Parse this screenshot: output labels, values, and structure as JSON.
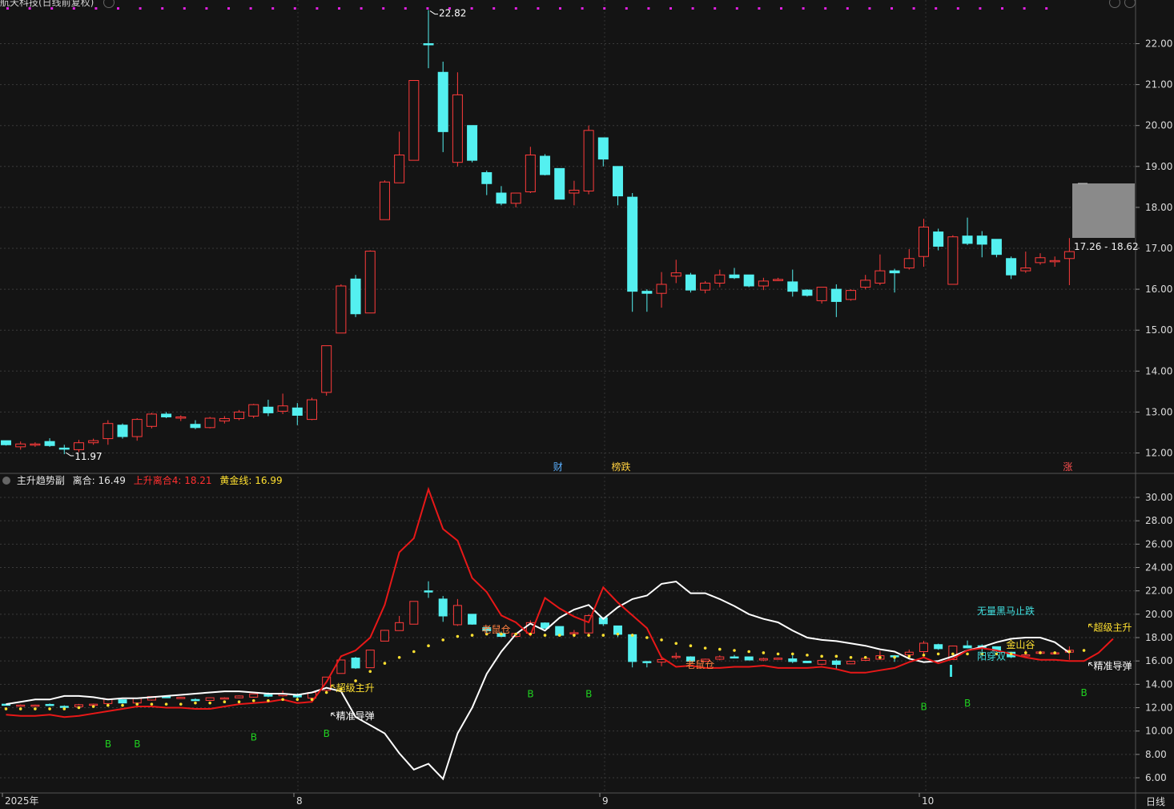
{
  "window": {
    "title": "航天科技(日线前复权)"
  },
  "indicator": {
    "name": "主升趋势副",
    "line1_label": "离合: 16.49",
    "line2_label": "上升离合4: 18.21",
    "line3_label": "黄金线: 16.99"
  },
  "timeframe_label": "日线",
  "colors": {
    "up": "#ff3b3b",
    "down": "#54f0f0",
    "white_line": "#ffffff",
    "red_line": "#e81818",
    "gold": "#ffe030",
    "buy": "#20d020",
    "grid": "#3a3a3a",
    "bg": "#141414"
  },
  "chart_data": [
    {
      "type": "candlestick",
      "name": "price",
      "y_ticks": [
        "22.00",
        "21.00",
        "20.00",
        "19.00",
        "18.00",
        "17.00",
        "16.00",
        "15.00",
        "14.00",
        "13.00",
        "12.00"
      ],
      "ylim": [
        11.5,
        23.0
      ],
      "ohlc": [
        [
          12.3,
          12.3,
          12.18,
          12.2
        ],
        [
          12.15,
          12.28,
          12.08,
          12.22
        ],
        [
          12.2,
          12.26,
          12.15,
          12.22
        ],
        [
          12.28,
          12.36,
          12.15,
          12.18
        ],
        [
          12.12,
          12.2,
          11.97,
          12.1
        ],
        [
          12.08,
          12.32,
          12.02,
          12.25
        ],
        [
          12.25,
          12.35,
          12.2,
          12.3
        ],
        [
          12.35,
          12.8,
          12.2,
          12.72
        ],
        [
          12.68,
          12.72,
          12.35,
          12.4
        ],
        [
          12.4,
          12.85,
          12.3,
          12.82
        ],
        [
          12.65,
          12.98,
          12.6,
          12.95
        ],
        [
          12.95,
          13.0,
          12.85,
          12.88
        ],
        [
          12.86,
          12.92,
          12.78,
          12.88
        ],
        [
          12.7,
          12.8,
          12.58,
          12.62
        ],
        [
          12.62,
          12.88,
          12.6,
          12.85
        ],
        [
          12.78,
          12.9,
          12.72,
          12.84
        ],
        [
          12.84,
          13.05,
          12.8,
          13.0
        ],
        [
          12.9,
          13.2,
          12.85,
          13.18
        ],
        [
          13.12,
          13.3,
          12.9,
          12.98
        ],
        [
          13.02,
          13.45,
          12.95,
          13.15
        ],
        [
          13.1,
          13.22,
          12.68,
          12.92
        ],
        [
          12.82,
          13.35,
          12.8,
          13.3
        ],
        [
          13.48,
          14.62,
          13.4,
          14.62
        ],
        [
          14.93,
          16.12,
          14.93,
          16.08
        ],
        [
          16.25,
          16.35,
          15.32,
          15.4
        ],
        [
          15.42,
          16.95,
          15.42,
          16.93
        ],
        [
          17.7,
          18.66,
          17.7,
          18.62
        ],
        [
          18.6,
          19.85,
          18.62,
          19.28
        ],
        [
          19.15,
          21.1,
          19.15,
          21.1
        ],
        [
          22.0,
          22.82,
          21.4,
          21.98
        ],
        [
          21.3,
          21.56,
          19.35,
          19.85
        ],
        [
          19.1,
          21.3,
          19.0,
          20.75
        ],
        [
          20.0,
          20.0,
          19.1,
          19.15
        ],
        [
          18.85,
          18.9,
          18.3,
          18.58
        ],
        [
          18.35,
          18.52,
          18.05,
          18.1
        ],
        [
          18.1,
          18.35,
          18.0,
          18.35
        ],
        [
          18.38,
          19.48,
          18.35,
          19.28
        ],
        [
          19.25,
          19.3,
          18.78,
          18.8
        ],
        [
          18.95,
          18.95,
          18.2,
          18.2
        ],
        [
          18.35,
          18.65,
          18.05,
          18.42
        ],
        [
          18.4,
          20.0,
          18.32,
          19.88
        ],
        [
          19.7,
          19.7,
          19.0,
          19.18
        ],
        [
          19.0,
          19.0,
          18.05,
          18.28
        ],
        [
          18.25,
          18.35,
          15.45,
          15.95
        ],
        [
          15.95,
          16.0,
          15.45,
          15.9
        ],
        [
          15.9,
          16.42,
          15.55,
          16.12
        ],
        [
          16.32,
          16.72,
          16.15,
          16.4
        ],
        [
          16.35,
          16.4,
          15.92,
          15.98
        ],
        [
          15.98,
          16.2,
          15.9,
          16.15
        ],
        [
          16.15,
          16.48,
          16.05,
          16.35
        ],
        [
          16.35,
          16.52,
          16.25,
          16.28
        ],
        [
          16.35,
          16.35,
          16.05,
          16.08
        ],
        [
          16.08,
          16.28,
          15.98,
          16.2
        ],
        [
          16.22,
          16.28,
          16.2,
          16.24
        ],
        [
          16.18,
          16.48,
          15.82,
          15.95
        ],
        [
          15.98,
          16.0,
          15.82,
          15.85
        ],
        [
          15.72,
          16.05,
          15.65,
          16.05
        ],
        [
          16.0,
          16.12,
          15.32,
          15.7
        ],
        [
          15.75,
          16.0,
          15.72,
          15.97
        ],
        [
          16.05,
          16.35,
          16.0,
          16.22
        ],
        [
          16.15,
          16.85,
          16.1,
          16.45
        ],
        [
          16.45,
          16.5,
          15.92,
          16.4
        ],
        [
          16.52,
          16.98,
          16.48,
          16.75
        ],
        [
          16.8,
          17.72,
          16.55,
          17.52
        ],
        [
          17.4,
          17.48,
          16.95,
          17.05
        ],
        [
          16.12,
          17.32,
          16.12,
          17.28
        ],
        [
          17.3,
          17.75,
          17.08,
          17.12
        ],
        [
          17.3,
          17.42,
          16.78,
          17.1
        ],
        [
          17.22,
          17.22,
          16.78,
          16.85
        ],
        [
          16.75,
          16.8,
          16.25,
          16.35
        ],
        [
          16.45,
          16.92,
          16.4,
          16.52
        ],
        [
          16.65,
          16.88,
          16.6,
          16.77
        ],
        [
          16.7,
          16.8,
          16.55,
          16.7
        ],
        [
          16.75,
          17.25,
          16.1,
          16.92
        ]
      ],
      "annotations": [
        {
          "text": "22.82",
          "candle": 29,
          "kind": "high"
        },
        {
          "text": "11.97",
          "candle": 4,
          "kind": "low"
        }
      ],
      "event_marks": [
        {
          "text": "财",
          "candle": 38,
          "color": "#5ab0ff"
        },
        {
          "text": "榜跌",
          "candle": 42,
          "color": "#ffd040"
        },
        {
          "text": "涨",
          "candle": 73,
          "color": "#ff5050"
        }
      ],
      "range_label": "17.26 - 18.62"
    },
    {
      "type": "line",
      "name": "主升趋势副",
      "y_ticks": [
        "30.00",
        "28.00",
        "26.00",
        "24.00",
        "22.00",
        "20.00",
        "18.00",
        "16.00",
        "14.00",
        "12.00",
        "10.00",
        "8.00",
        "6.00"
      ],
      "ylim": [
        5.0,
        31.2
      ],
      "x_ticks": [
        "2025年",
        "8",
        "9",
        "10"
      ],
      "series": [
        {
          "name": "离合",
          "color": "#ffffff",
          "values": [
            12.3,
            12.5,
            12.7,
            12.7,
            13.0,
            13.0,
            12.9,
            12.7,
            12.8,
            12.8,
            12.9,
            13.0,
            13.1,
            13.2,
            13.3,
            13.4,
            13.4,
            13.3,
            13.2,
            13.2,
            13.1,
            13.3,
            13.7,
            13.4,
            11.2,
            10.5,
            9.8,
            8.1,
            6.7,
            7.2,
            5.9,
            9.8,
            12.0,
            14.9,
            16.8,
            18.3,
            19.2,
            18.6,
            19.7,
            20.4,
            20.8,
            19.6,
            20.6,
            21.3,
            21.6,
            22.6,
            22.8,
            21.8,
            21.8,
            21.3,
            20.7,
            20.0,
            19.6,
            19.3,
            18.6,
            18.0,
            17.8,
            17.7,
            17.5,
            17.3,
            17.0,
            16.8,
            16.2,
            15.9,
            16.0,
            16.4,
            16.9,
            17.2,
            17.6,
            17.9,
            18.0,
            18.0,
            17.6,
            16.7
          ]
        },
        {
          "name": "上升离合4",
          "color": "#e81818",
          "values": [
            11.4,
            11.3,
            11.3,
            11.4,
            11.2,
            11.3,
            11.5,
            11.7,
            11.9,
            12.1,
            12.1,
            12.0,
            12.0,
            11.9,
            11.9,
            12.1,
            12.3,
            12.4,
            12.5,
            12.7,
            12.4,
            12.5,
            14.2,
            16.4,
            16.9,
            18.0,
            20.8,
            25.3,
            26.5,
            30.7,
            27.3,
            26.3,
            23.1,
            21.9,
            19.9,
            19.3,
            18.2,
            21.4,
            20.5,
            19.8,
            19.3,
            22.3,
            21.0,
            19.9,
            18.8,
            16.3,
            15.5,
            15.6,
            15.4,
            15.4,
            15.5,
            15.5,
            15.6,
            15.4,
            15.4,
            15.4,
            15.5,
            15.3,
            15.0,
            15.0,
            15.2,
            15.4,
            15.9,
            16.3,
            15.8,
            16.2,
            16.9,
            17.1,
            16.9,
            16.6,
            16.3,
            16.1,
            16.1,
            16.0,
            16.0,
            16.7,
            17.9
          ]
        },
        {
          "name": "黄金线",
          "color": "#ffe030",
          "dotted": true,
          "values": [
            11.9,
            11.9,
            11.9,
            11.9,
            11.9,
            12.0,
            12.1,
            12.2,
            12.2,
            12.3,
            12.3,
            12.3,
            12.3,
            12.4,
            12.4,
            12.5,
            12.5,
            12.6,
            12.6,
            12.7,
            12.7,
            12.7,
            13.3,
            13.6,
            14.3,
            15.1,
            15.8,
            16.3,
            16.8,
            17.3,
            17.8,
            18.1,
            18.2,
            18.3,
            18.3,
            18.3,
            18.3,
            18.2,
            18.2,
            18.2,
            18.2,
            18.2,
            18.3,
            18.2,
            18.0,
            17.8,
            17.5,
            17.3,
            17.1,
            17.0,
            16.9,
            16.8,
            16.7,
            16.6,
            16.6,
            16.5,
            16.4,
            16.4,
            16.3,
            16.3,
            16.3,
            16.3,
            16.4,
            16.5,
            16.6,
            16.6,
            16.6,
            16.6,
            16.6,
            16.6,
            16.7,
            16.7,
            16.7,
            16.8,
            16.9
          ]
        }
      ],
      "labels": [
        {
          "text": "超级主升",
          "candle": 22,
          "y": 13.4,
          "color": "#ffe030",
          "arrow": "up"
        },
        {
          "text": "精准导弹",
          "candle": 22,
          "y": 11.0,
          "color": "#ffffff",
          "arrow": "up"
        },
        {
          "text": "老鼠仓",
          "candle": 32,
          "y": 18.4,
          "color": "#ff8040",
          "arrow": "none"
        },
        {
          "text": "老鼠仓",
          "candle": 46,
          "y": 15.4,
          "color": "#ff8040",
          "arrow": "none"
        },
        {
          "text": "无量黑马止跌",
          "candle": 66,
          "y": 20.0,
          "color": "#40e0e0",
          "arrow": "none"
        },
        {
          "text": "阳穿双",
          "candle": 66,
          "y": 16.1,
          "color": "#40e0e0",
          "arrow": "none"
        },
        {
          "text": "金山谷",
          "candle": 68,
          "y": 17.1,
          "color": "#ffe030",
          "arrow": "none"
        },
        {
          "text": "超级主升",
          "candle": 74,
          "y": 18.6,
          "color": "#ffe030",
          "arrow": "up"
        },
        {
          "text": "精准导弹",
          "candle": 74,
          "y": 15.3,
          "color": "#ffffff",
          "arrow": "up"
        }
      ],
      "buy_marks": [
        {
          "text": "B",
          "candle": 7,
          "y": 8.6
        },
        {
          "text": "B",
          "candle": 9,
          "y": 8.6
        },
        {
          "text": "B",
          "candle": 17,
          "y": 9.2
        },
        {
          "text": "B",
          "candle": 22,
          "y": 9.5
        },
        {
          "text": "B",
          "candle": 36,
          "y": 12.9
        },
        {
          "text": "B",
          "candle": 40,
          "y": 12.9
        },
        {
          "text": "B",
          "candle": 63,
          "y": 11.8
        },
        {
          "text": "B",
          "candle": 66,
          "y": 12.1
        },
        {
          "text": "B",
          "candle": 74,
          "y": 13.0
        }
      ]
    }
  ]
}
